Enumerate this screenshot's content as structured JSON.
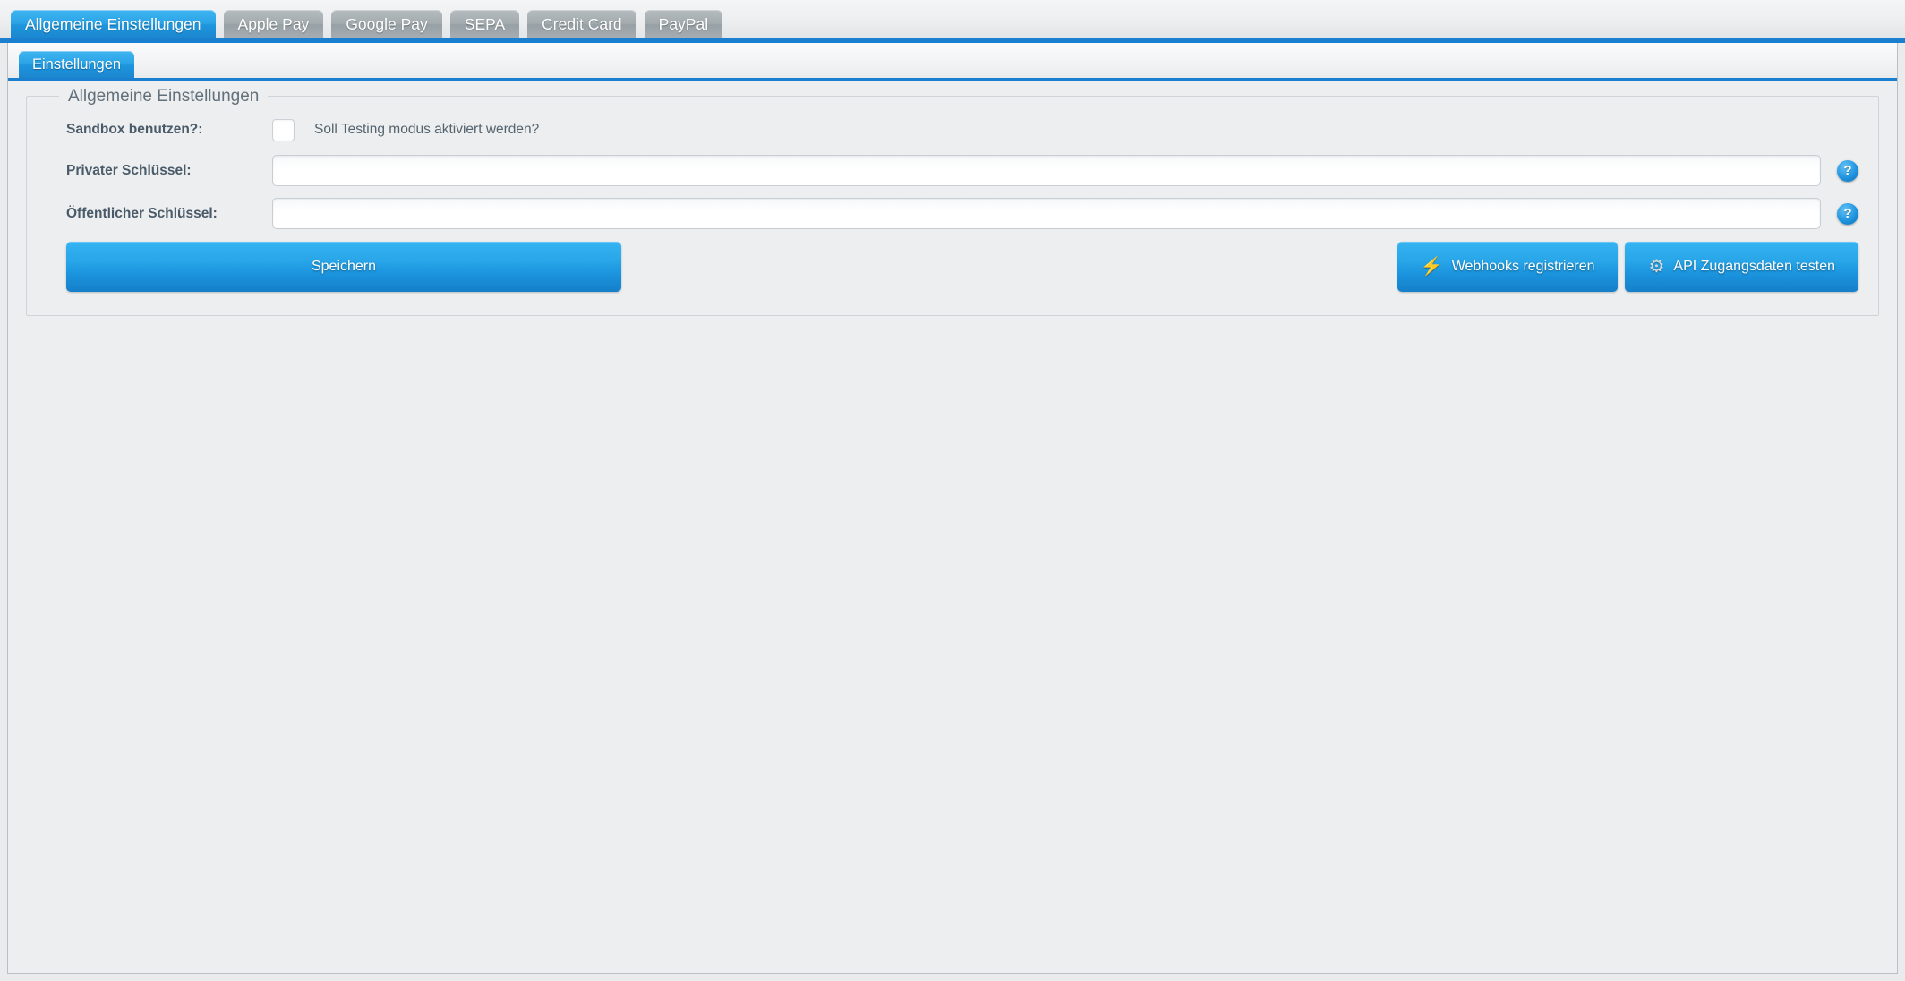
{
  "outer_tabs": [
    {
      "label": "Allgemeine Einstellungen",
      "active": true
    },
    {
      "label": "Apple Pay",
      "active": false
    },
    {
      "label": "Google Pay",
      "active": false
    },
    {
      "label": "SEPA",
      "active": false
    },
    {
      "label": "Credit Card",
      "active": false
    },
    {
      "label": "PayPal",
      "active": false
    }
  ],
  "inner_tabs": [
    {
      "label": "Einstellungen",
      "active": true
    }
  ],
  "fieldset": {
    "legend": "Allgemeine Einstellungen"
  },
  "form": {
    "sandbox": {
      "label": "Sandbox benutzen?:",
      "checked": false,
      "hint": "Soll Testing modus aktiviert werden?"
    },
    "private_key": {
      "label": "Privater Schlüssel:",
      "value": "",
      "placeholder": "",
      "help_icon": "question-mark-icon"
    },
    "public_key": {
      "label": "Öffentlicher Schlüssel:",
      "value": "",
      "placeholder": "",
      "help_icon": "question-mark-icon"
    }
  },
  "buttons": {
    "save": "Speichern",
    "webhooks": "Webhooks registrieren",
    "webhooks_icon": "lightning-bolt-icon",
    "api_test": "API Zugangsdaten testen",
    "api_test_icon": "gear-icon"
  },
  "colors": {
    "accent_blue": "#1b7fd0",
    "tab_active": "#2aa3e6",
    "tab_inactive": "#a3abaf",
    "page_bg": "#e9ebed",
    "panel_bg": "#eceeef",
    "label_text": "#4a5a68",
    "bolt_yellow": "#f3c015",
    "gear_gray": "#d6d9db"
  }
}
